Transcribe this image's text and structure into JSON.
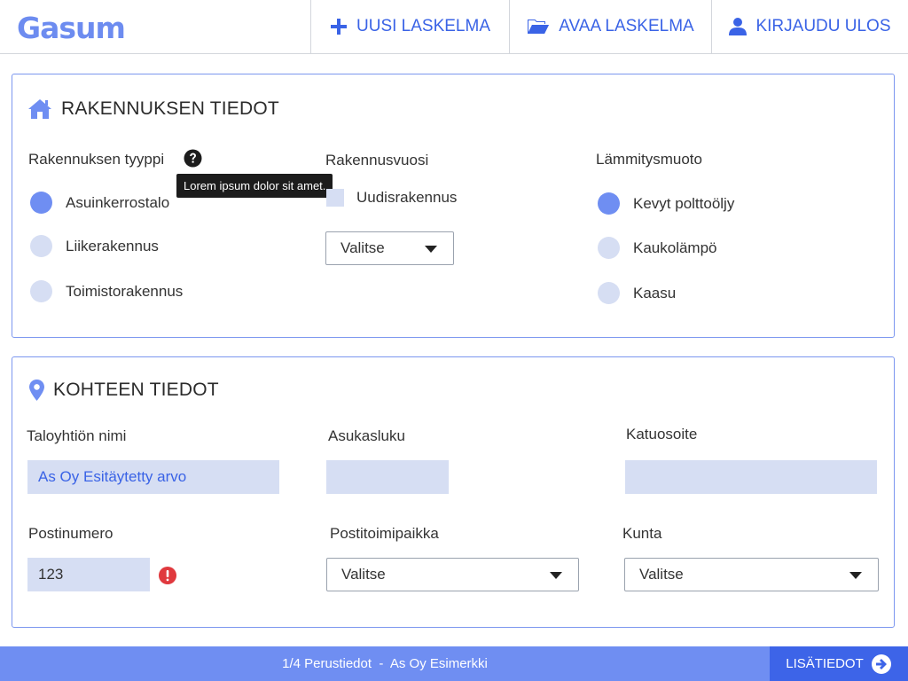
{
  "header": {
    "logo": "Gasum",
    "nav": {
      "new_calc": "UUSI LASKELMA",
      "open_calc": "AVAA LASKELMA",
      "logout": "KIRJAUDU ULOS"
    }
  },
  "building": {
    "title": "RAKENNUKSEN TIEDOT",
    "type_label": "Rakennuksen tyyppi",
    "tooltip": "Lorem ipsum dolor sit amet.",
    "types": [
      "Asuinkerrostalo",
      "Liikerakennus",
      "Toimistorakennus"
    ],
    "selected_type": "Asuinkerrostalo",
    "year_label": "Rakennusvuosi",
    "new_building_label": "Uudisrakennus",
    "new_building_checked": false,
    "year_select": "Valitse",
    "heating_label": "Lämmitysmuoto",
    "heating_types": [
      "Kevyt polttoöljy",
      "Kaukolämpö",
      "Kaasu"
    ],
    "selected_heating": "Kevyt polttoöljy"
  },
  "target": {
    "title": "KOHTEEN TIEDOT",
    "company_label": "Taloyhtiön nimi",
    "company_value": "As Oy Esitäytetty arvo",
    "residents_label": "Asukasluku",
    "residents_value": "",
    "street_label": "Katuosoite",
    "street_value": "",
    "postcode_label": "Postinumero",
    "postcode_value": "123",
    "city_label": "Postitoimipaikka",
    "city_select": "Valitse",
    "municipality_label": "Kunta",
    "municipality_select": "Valitse"
  },
  "footer": {
    "status": "1/4 Perustiedot  -  As Oy Esimerkki",
    "next_label": "LISÄTIEDOT"
  },
  "colors": {
    "accent": "#6f8ef2",
    "accent_dark": "#3d64e8",
    "link": "#3a63e6",
    "input_bg": "#d6def3",
    "error": "#e0393e"
  }
}
